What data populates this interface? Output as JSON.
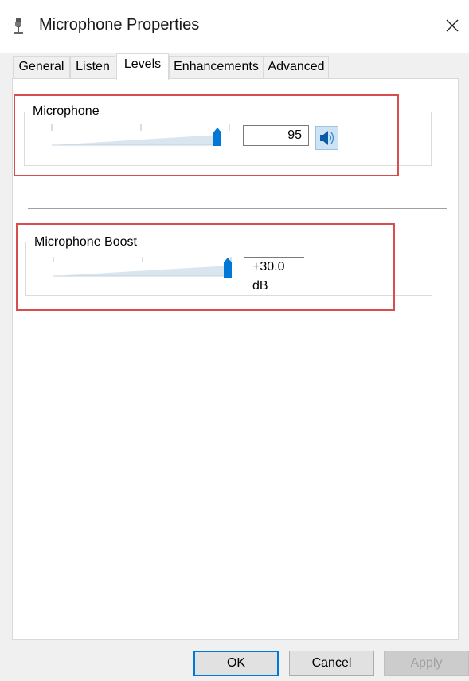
{
  "window": {
    "title": "Microphone Properties",
    "close_glyph": "✕"
  },
  "tabs": [
    {
      "label": "General"
    },
    {
      "label": "Listen"
    },
    {
      "label": "Levels"
    },
    {
      "label": "Enhancements"
    },
    {
      "label": "Advanced"
    }
  ],
  "active_tab": "Levels",
  "microphone": {
    "label": "Microphone",
    "value": "95",
    "slider_level": 0.95
  },
  "boost": {
    "label": "Microphone Boost",
    "value": "+30.0 dB",
    "slider_level": 1.0
  },
  "buttons": {
    "ok": "OK",
    "cancel": "Cancel",
    "apply": "Apply"
  },
  "colors": {
    "accent": "#0078d7",
    "highlight": "#d84d4d"
  },
  "icons": {
    "window": "microphone-icon",
    "mute_toggle": "speaker-icon"
  }
}
